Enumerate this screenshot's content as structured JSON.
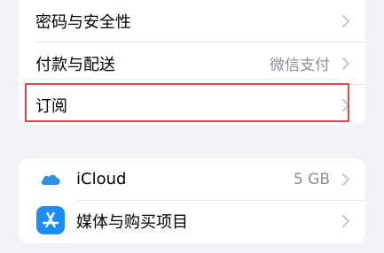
{
  "group1": {
    "items": [
      {
        "label": "密码与安全性",
        "value": ""
      },
      {
        "label": "付款与配送",
        "value": "微信支付"
      },
      {
        "label": "订阅",
        "value": ""
      }
    ]
  },
  "group2": {
    "items": [
      {
        "label": "iCloud",
        "value": "5 GB",
        "icon": "icloud-cloud-icon"
      },
      {
        "label": "媒体与购买项目",
        "value": "",
        "icon": "app-store-icon"
      }
    ]
  },
  "colors": {
    "highlight_border": "#d9484b",
    "icloud_blue": "#2e8ee8",
    "appstore_blue": "#1c8df2",
    "secondary_text": "#8e8e93",
    "background": "#f2f2f7"
  }
}
